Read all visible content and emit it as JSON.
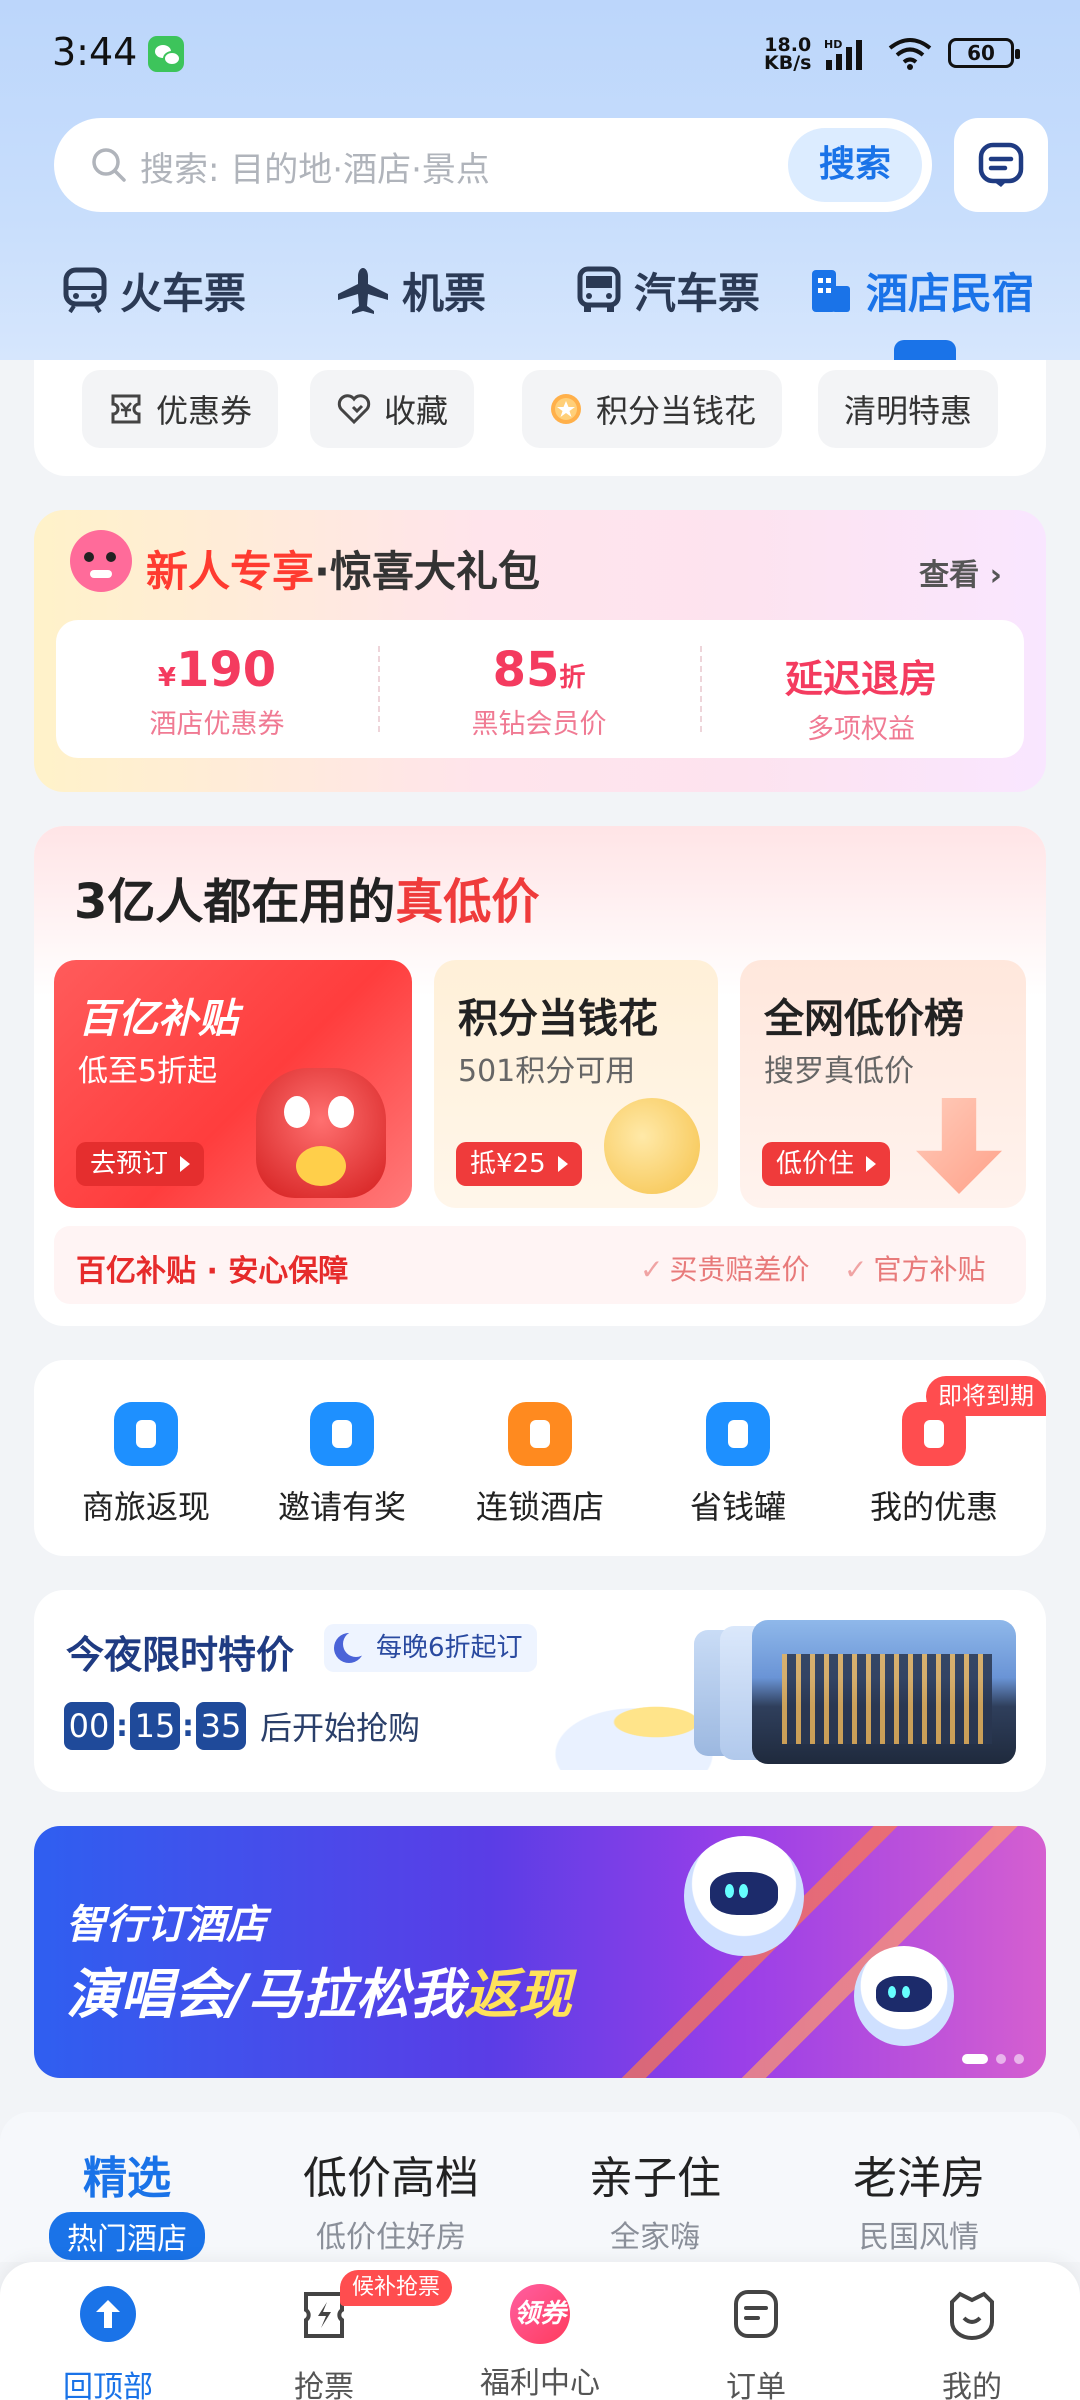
{
  "status_bar": {
    "time": "3:44",
    "net_speed_value": "18.0",
    "net_speed_unit": "KB/s",
    "net_type": "HD",
    "battery": "60"
  },
  "search": {
    "placeholder": "搜索: 目的地·酒店·景点",
    "button_label": "搜索"
  },
  "category_tabs": [
    {
      "label": "火车票",
      "icon": "train-icon"
    },
    {
      "label": "机票",
      "icon": "plane-icon"
    },
    {
      "label": "汽车票",
      "icon": "bus-icon"
    },
    {
      "label": "酒店民宿",
      "icon": "hotel-icon",
      "active": true
    }
  ],
  "chips": [
    {
      "label": "优惠券",
      "icon": "coupon-icon"
    },
    {
      "label": "收藏",
      "icon": "heart-icon"
    },
    {
      "label": "积分当钱花",
      "icon": "points-icon"
    },
    {
      "label": "清明特惠"
    }
  ],
  "newcomer": {
    "title_red": "新人专享",
    "title_dark": "·惊喜大礼包",
    "view_label": "查看",
    "perks": [
      {
        "prefix": "¥",
        "value": "190",
        "suffix": "",
        "label": "酒店优惠券"
      },
      {
        "prefix": "",
        "value": "85",
        "suffix": "折",
        "label": "黑钻会员价"
      },
      {
        "prefix": "",
        "value": "延迟退房",
        "suffix": "",
        "label": "多项权益"
      }
    ]
  },
  "lowprice": {
    "title_dark": "3亿人都在用的",
    "title_red": "真低价",
    "promos": [
      {
        "title": "百亿补贴",
        "subtitle": "低至5折起",
        "button": "去预订"
      },
      {
        "title": "积分当钱花",
        "subtitle": "501积分可用",
        "button": "抵¥25"
      },
      {
        "title": "全网低价榜",
        "subtitle": "搜罗真低价",
        "button": "低价住"
      }
    ],
    "guarantee": {
      "left": "百亿补贴 · 安心保障",
      "items": [
        "买贵赔差价",
        "官方补贴"
      ]
    }
  },
  "functions": [
    {
      "label": "商旅返现",
      "color": "#1e90ff",
      "icon": "business-cashback-icon"
    },
    {
      "label": "邀请有奖",
      "color": "#1e90ff",
      "icon": "invite-icon"
    },
    {
      "label": "连锁酒店",
      "color": "#ff8a1f",
      "icon": "chain-hotel-icon"
    },
    {
      "label": "省钱罐",
      "color": "#1e90ff",
      "icon": "savings-jar-icon"
    },
    {
      "label": "我的优惠",
      "color": "#ff4d4f",
      "icon": "my-coupon-icon",
      "badge": "即将到期"
    }
  ],
  "tonight": {
    "title": "今夜限时特价",
    "tag": "每晚6折起订",
    "countdown": [
      "00",
      "15",
      "35"
    ],
    "countdown_text": "后开始抢购"
  },
  "banner": {
    "subtitle": "智行订酒店",
    "main_white": "演唱会/马拉松我",
    "main_yellow": "返现"
  },
  "feed_tabs": [
    {
      "title": "精选",
      "sub": "热门酒店",
      "active": true
    },
    {
      "title": "低价高档",
      "sub": "低价住好房"
    },
    {
      "title": "亲子住",
      "sub": "全家嗨"
    },
    {
      "title": "老洋房",
      "sub": "民国风情"
    }
  ],
  "bottom_nav": {
    "items": [
      {
        "label": "回顶部",
        "icon": "back-to-top-icon",
        "active": true
      },
      {
        "label": "抢票",
        "icon": "grab-ticket-icon"
      },
      {
        "label": "福利中心",
        "icon": "welfare-center-icon",
        "icon_text": "领券"
      },
      {
        "label": "订单",
        "icon": "order-icon"
      },
      {
        "label": "我的",
        "icon": "profile-icon"
      }
    ],
    "badge": "候补抢票"
  },
  "colors": {
    "accent": "#1a73e8",
    "brand_red": "#ef3b3b",
    "navy": "#1f4a9a"
  }
}
